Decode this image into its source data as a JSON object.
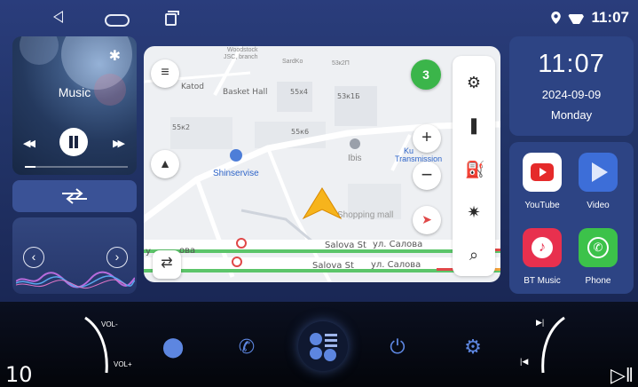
{
  "status": {
    "time": "11:07",
    "icons": [
      "back-icon",
      "home-icon",
      "recent-apps-icon",
      "location-icon",
      "wifi-icon"
    ]
  },
  "music": {
    "title": "Music",
    "progress": 0.1
  },
  "map": {
    "labels": {
      "woodstock": "Woodstock",
      "jsc_branch": "JSC, branch",
      "sardko": "SardKo",
      "katod": "Katod",
      "basket_hall": "Basket Hall",
      "b55x4": "55x4",
      "b53x2p": "53к2П",
      "b53x1b": "53к1Б",
      "b55x2": "55к2",
      "b55x6": "55к6",
      "shinservise": "Shinservise",
      "ibis": "Ibis",
      "transmission_a": "Ku",
      "transmission_b": "Transmission",
      "shopping": "Shopping mall",
      "street1": "Salova St",
      "street1_ru": "ул. Салова",
      "street2": "Salova St",
      "street2_ru": "ул. Салова",
      "street_left": "у",
      "street_left2": "ова",
      "badge": "3"
    }
  },
  "clock": {
    "time": "11:07",
    "date": "2024-09-09",
    "day": "Monday"
  },
  "apps": [
    {
      "name": "YouTube",
      "color": "#e52a2a"
    },
    {
      "name": "Video",
      "color": "#3d6ed8"
    },
    {
      "name": "BT Music",
      "color": "#e8304e"
    },
    {
      "name": "Phone",
      "color": "#3cc24a"
    }
  ],
  "dock": {
    "vol_minus": "VOL-",
    "vol_plus": "VOL+",
    "number": "10",
    "icons": [
      "location-icon",
      "phone-icon",
      "apps-grid-icon",
      "power-icon",
      "settings-icon"
    ]
  }
}
